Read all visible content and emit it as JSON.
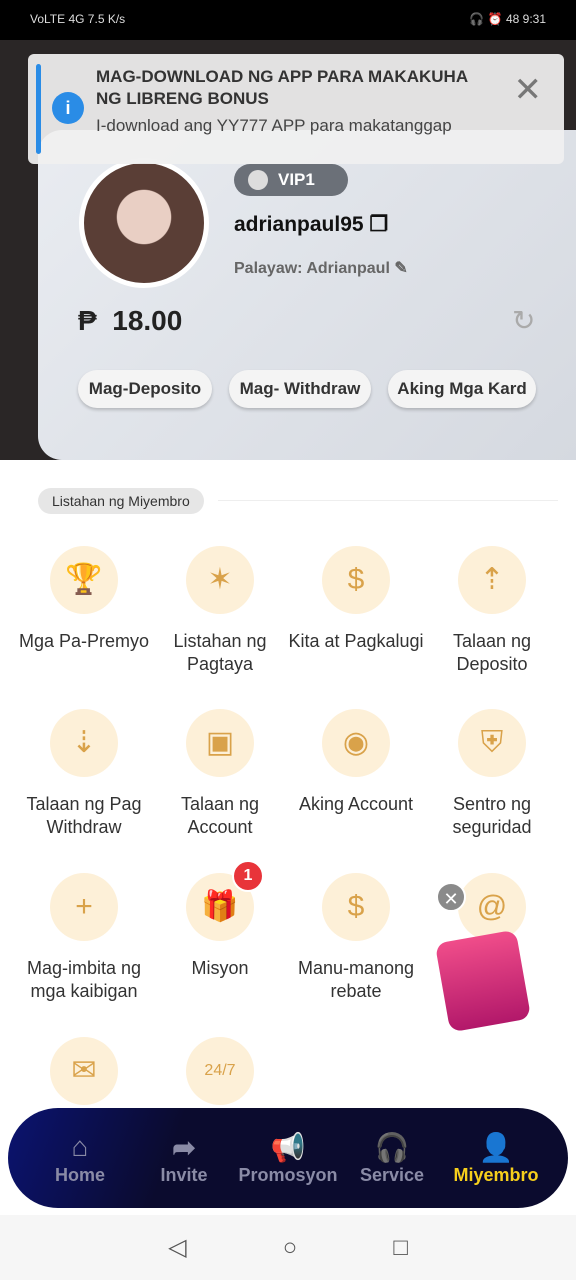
{
  "status": {
    "left": "VoLTE 4G 7.5 K/s",
    "time": "9:31",
    "battery": "48"
  },
  "notification": {
    "title": "MAG-DOWNLOAD NG APP PARA MAKAKUHA NG LIBRENG BONUS",
    "body": "I-download ang YY777 APP para makatanggap"
  },
  "profile": {
    "vip": "VIP1",
    "username": "adrianpaul95",
    "nickname": "Palayaw: Adrianpaul",
    "currency": "₱",
    "balance": "18.00"
  },
  "actions": [
    "Mag-Deposito",
    "Mag- Withdraw",
    "Aking Mga Kard"
  ],
  "section": "Listahan ng Miyembro",
  "items": [
    {
      "label": "Mga Pa-Premyo",
      "icon": "trophy-icon",
      "g": "🏆"
    },
    {
      "label": "Listahan ng Pagtaya",
      "icon": "sparkle-icon",
      "g": "✶"
    },
    {
      "label": "Kita at Pagkalugi",
      "icon": "receipt-icon",
      "g": "$"
    },
    {
      "label": "Talaan ng Deposito",
      "icon": "clipboard-up-icon",
      "g": "⇡"
    },
    {
      "label": "Talaan ng Pag Withdraw",
      "icon": "clipboard-down-icon",
      "g": "⇣"
    },
    {
      "label": "Talaan ng Account",
      "icon": "account-record-icon",
      "g": "▣"
    },
    {
      "label": "Aking Account",
      "icon": "user-icon",
      "g": "◉"
    },
    {
      "label": "Sentro ng seguridad",
      "icon": "shield-icon",
      "g": "⛨"
    },
    {
      "label": "Mag-imbita ng mga kaibigan",
      "icon": "invite-user-icon",
      "g": "+"
    },
    {
      "label": "Misyon",
      "icon": "gift-icon",
      "g": "🎁"
    },
    {
      "label": "Manu-manong rebate",
      "icon": "coins-icon",
      "g": "$"
    },
    {
      "label": "",
      "icon": "at-icon",
      "g": "@"
    },
    {
      "label": "",
      "icon": "feedback-icon",
      "g": "✉"
    },
    {
      "label": "",
      "icon": "support-24-7-icon",
      "g": "24/7"
    }
  ],
  "mission_badge": "1",
  "nav": [
    {
      "label": "Home",
      "g": "⌂"
    },
    {
      "label": "Invite",
      "g": "➦"
    },
    {
      "label": "Promosyon",
      "g": "📢"
    },
    {
      "label": "Service",
      "g": "🎧"
    },
    {
      "label": "Miyembro",
      "g": "👤"
    }
  ],
  "colors": {
    "accent": "#f6cf1c",
    "nav_bg": "#0b0b2e",
    "info": "#2a8ce6"
  }
}
